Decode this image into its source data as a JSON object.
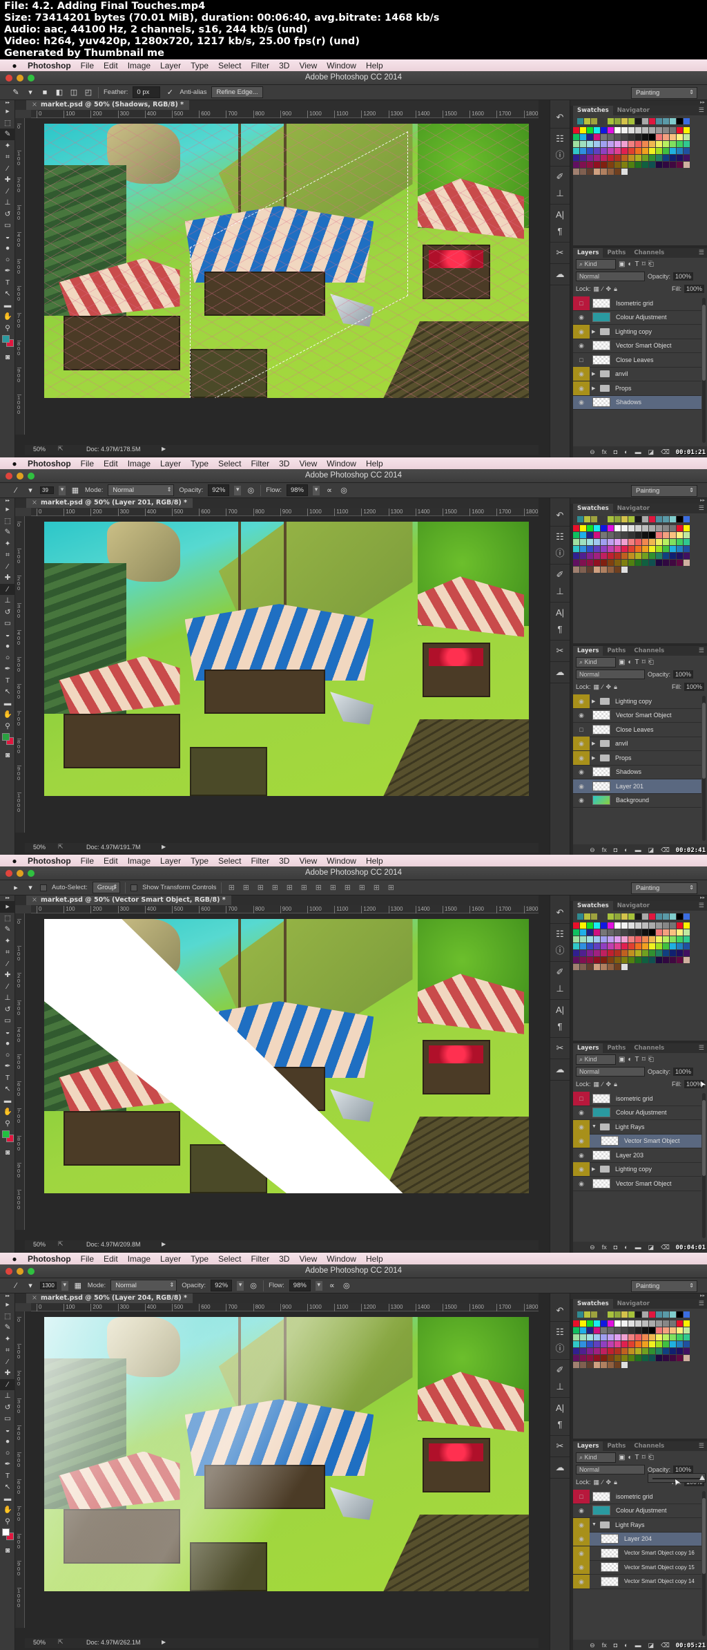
{
  "header": {
    "file_line": "File: 4.2. Adding Final Touches.mp4",
    "size_line": "Size: 73414201 bytes (70.01 MiB), duration: 00:06:40, avg.bitrate: 1468 kb/s",
    "audio_line": "Audio: aac, 44100 Hz, 2 channels, s16, 244 kb/s (und)",
    "video_line": "Video: h264, yuv420p, 1280x720, 1217 kb/s, 25.00 fps(r) (und)",
    "generated_line": "Generated by Thumbnail me"
  },
  "menubar": {
    "apple": "",
    "app": "Photoshop",
    "items": [
      "File",
      "Edit",
      "Image",
      "Layer",
      "Type",
      "Select",
      "Filter",
      "3D",
      "View",
      "Window",
      "Help"
    ]
  },
  "window_title": "Adobe Photoshop CC 2014",
  "workspace": "Painting",
  "ruler": {
    "h_ticks": [
      "0",
      "100",
      "200",
      "300",
      "400",
      "500",
      "600",
      "700",
      "800",
      "900",
      "1000",
      "1100",
      "1200",
      "1300",
      "1400",
      "1500",
      "1600",
      "1700",
      "1800"
    ],
    "v_ticks": [
      "0",
      "100",
      "200",
      "300",
      "400",
      "500",
      "600",
      "700",
      "800",
      "900",
      "1000"
    ]
  },
  "tools": [
    {
      "name": "move-tool",
      "glyph": "▸"
    },
    {
      "name": "marquee-tool",
      "glyph": "⬚"
    },
    {
      "name": "lasso-tool",
      "glyph": "✎"
    },
    {
      "name": "magic-wand-tool",
      "glyph": "✦"
    },
    {
      "name": "crop-tool",
      "glyph": "⌗"
    },
    {
      "name": "eyedropper-tool",
      "glyph": "⁄"
    },
    {
      "name": "healing-brush-tool",
      "glyph": "✚"
    },
    {
      "name": "brush-tool",
      "glyph": "∕"
    },
    {
      "name": "clone-stamp-tool",
      "glyph": "⊥"
    },
    {
      "name": "history-brush-tool",
      "glyph": "↺"
    },
    {
      "name": "eraser-tool",
      "glyph": "▭"
    },
    {
      "name": "paint-bucket-tool",
      "glyph": "◒"
    },
    {
      "name": "blur-tool",
      "glyph": "●"
    },
    {
      "name": "dodge-tool",
      "glyph": "○"
    },
    {
      "name": "pen-tool",
      "glyph": "✒"
    },
    {
      "name": "type-tool",
      "glyph": "T"
    },
    {
      "name": "path-selection-tool",
      "glyph": "↖"
    },
    {
      "name": "rectangle-tool",
      "glyph": "▬"
    },
    {
      "name": "hand-tool",
      "glyph": "✋"
    },
    {
      "name": "zoom-tool",
      "glyph": "⚲"
    }
  ],
  "dock_icons": [
    {
      "name": "history-icon",
      "glyph": "↶"
    },
    {
      "name": "properties-icon",
      "glyph": "☷"
    },
    {
      "name": "info-icon",
      "glyph": "ⓘ"
    },
    {
      "name": "brush-presets-icon",
      "glyph": "✐"
    },
    {
      "name": "clone-source-icon",
      "glyph": "⊥"
    },
    {
      "name": "character-icon",
      "glyph": "A|"
    },
    {
      "name": "paragraph-icon",
      "glyph": "¶"
    },
    {
      "name": "tool-presets-icon",
      "glyph": "✂"
    },
    {
      "name": "creative-cloud-icon",
      "glyph": "☁"
    }
  ],
  "swatches": {
    "tabs": [
      "Swatches",
      "Navigator"
    ],
    "recent": [
      "#2f8a91",
      "#b9c23d",
      "#9ea23e",
      "#3a3a3a",
      "#a8c33d",
      "#8fa83a",
      "#d4c24a",
      "#a6c23a",
      "#1a1a1a",
      "#a9a9a9",
      "#e0173f",
      "#4f8fa0",
      "#5a9aa8",
      "#7fcccc",
      "#000000",
      "#3b6de0"
    ],
    "grid": [
      "#e8102a",
      "#fff200",
      "#12e02a",
      "#18ecf0",
      "#1018e0",
      "#e010e0",
      "#ffffff",
      "#f2f2f2",
      "#e0e0e0",
      "#cfcfcf",
      "#bdbdbd",
      "#ababab",
      "#999999",
      "#878787",
      "#757575",
      "#e8102a",
      "#fff200",
      "#10c060",
      "#20b0e8",
      "#20208a",
      "#d01080",
      "#777777",
      "#666666",
      "#555555",
      "#444444",
      "#333333",
      "#222222",
      "#111111",
      "#000000",
      "#f07878",
      "#f4a080",
      "#f8c080",
      "#fff080",
      "#c0e8a0",
      "#a0e0a0",
      "#a0e0c0",
      "#a0e0e0",
      "#a0c8f0",
      "#a0a0f0",
      "#c0a0f0",
      "#e0a0f0",
      "#f0a0d0",
      "#f08080",
      "#f06060",
      "#f08850",
      "#f0b850",
      "#f0f060",
      "#b8f060",
      "#80e060",
      "#40d060",
      "#30c890",
      "#30c8c8",
      "#3090e0",
      "#3050c8",
      "#6040c0",
      "#9040c0",
      "#c040b0",
      "#e04090",
      "#e02050",
      "#e04030",
      "#f07020",
      "#f0a020",
      "#f0f020",
      "#a0e020",
      "#40c040",
      "#20b0e0",
      "#2080c0",
      "#2050a0",
      "#302090",
      "#502090",
      "#802090",
      "#a02080",
      "#c02060",
      "#c02030",
      "#b03020",
      "#c06020",
      "#c09020",
      "#b0b020",
      "#70a020",
      "#309030",
      "#208060",
      "#104080",
      "#102070",
      "#201060",
      "#401060",
      "#601060",
      "#801050",
      "#901040",
      "#901020",
      "#802010",
      "#804010",
      "#806010",
      "#808010",
      "#508010",
      "#207020",
      "#106040",
      "#105050",
      "#200840",
      "#300840",
      "#400840",
      "#600840",
      "#d0b0a0",
      "#a08070",
      "#806050",
      "#604030",
      "#d0a080",
      "#b08060",
      "#906040",
      "#704020",
      "#e0e0e0",
      "#3c3c3c",
      "#3c3c3c",
      "#3c3c3c",
      "#3c3c3c"
    ]
  },
  "layers_panel": {
    "tabs": [
      "Layers",
      "Paths",
      "Channels"
    ],
    "kind": "Kind",
    "blend": "Normal",
    "opacity_label": "Opacity:",
    "fill_label": "Fill:",
    "lock_label": "Lock:",
    "opacity_value": "100%",
    "fill_value": "100%"
  },
  "frames": [
    {
      "options": {
        "tool": "lasso",
        "feather_label": "Feather:",
        "feather_value": "0 px",
        "antialias_label": "Anti-alias",
        "refine_label": "Refine Edge..."
      },
      "doc_tab": "market.psd @ 50% (Shadows, RGB/8) *",
      "zoom": "50%",
      "doc_info": "Doc: 4.97M/178.5M",
      "fg_color": "#2a9aa0",
      "bg_color": "#e0173f",
      "timestamp": "00:01:21",
      "layers": [
        {
          "name": "Isometric grid",
          "eye": "red",
          "type": "layer",
          "partial": true
        },
        {
          "name": "Colour Adjustment",
          "eye": "on",
          "type": "fill",
          "fill": "#2a9aa0"
        },
        {
          "name": "Lighting copy",
          "eye": "yellow",
          "type": "group"
        },
        {
          "name": "Vector Smart Object",
          "eye": "on",
          "type": "smart"
        },
        {
          "name": "Close Leaves",
          "eye": "off",
          "type": "layer"
        },
        {
          "name": "anvil",
          "eye": "yellow",
          "type": "group"
        },
        {
          "name": "Props",
          "eye": "yellow",
          "type": "group"
        },
        {
          "name": "Shadows",
          "eye": "on",
          "type": "layer",
          "selected": true
        }
      ]
    },
    {
      "options": {
        "tool": "brush",
        "brush_size": "39",
        "mode_label": "Mode:",
        "mode_value": "Normal",
        "opacity_label": "Opacity:",
        "opacity_value": "92%",
        "flow_label": "Flow:",
        "flow_value": "98%"
      },
      "doc_tab": "market.psd @ 50% (Layer 201, RGB/8) *",
      "zoom": "50%",
      "doc_info": "Doc: 4.97M/191.7M",
      "fg_color": "#2aa040",
      "bg_color": "#e0173f",
      "timestamp": "00:02:41",
      "layers": [
        {
          "name": "Lighting copy",
          "eye": "yellow",
          "type": "group"
        },
        {
          "name": "Vector Smart Object",
          "eye": "on",
          "type": "smart"
        },
        {
          "name": "Close Leaves",
          "eye": "off",
          "type": "layer"
        },
        {
          "name": "anvil",
          "eye": "yellow",
          "type": "group"
        },
        {
          "name": "Props",
          "eye": "yellow",
          "type": "group"
        },
        {
          "name": "Shadows",
          "eye": "on",
          "type": "layer"
        },
        {
          "name": "Layer 201",
          "eye": "on",
          "type": "layer",
          "selected": true
        },
        {
          "name": "Background",
          "eye": "on",
          "type": "image"
        }
      ]
    },
    {
      "options": {
        "tool": "move",
        "autoselect_label": "Auto-Select:",
        "autoselect_value": "Group",
        "transform_label": "Show Transform Controls"
      },
      "doc_tab": "market.psd @ 50% (Vector Smart Object, RGB/8) *",
      "zoom": "50%",
      "doc_info": "Doc: 4.97M/209.8M",
      "fg_color": "#20c040",
      "bg_color": "#e0173f",
      "timestamp": "00:04:01",
      "layers": [
        {
          "name": "isometric grid",
          "eye": "red",
          "type": "layer"
        },
        {
          "name": "Colour Adjustment",
          "eye": "on",
          "type": "fill",
          "fill": "#2a9aa0"
        },
        {
          "name": "Light Rays",
          "eye": "yellow",
          "type": "group-open"
        },
        {
          "name": "Vector Smart Object",
          "eye": "yellow",
          "type": "layer",
          "child": true,
          "selected": true
        },
        {
          "name": "Layer 203",
          "eye": "on",
          "type": "layer"
        },
        {
          "name": "Lighting copy",
          "eye": "yellow",
          "type": "group"
        },
        {
          "name": "Vector Smart Object",
          "eye": "on",
          "type": "smart"
        }
      ]
    },
    {
      "options": {
        "tool": "brush",
        "brush_size": "1300",
        "mode_label": "Mode:",
        "mode_value": "Normal",
        "opacity_label": "Opacity:",
        "opacity_value": "92%",
        "flow_label": "Flow:",
        "flow_value": "98%"
      },
      "doc_tab": "market.psd @ 50% (Layer 204, RGB/8) *",
      "zoom": "50%",
      "doc_info": "Doc: 4.97M/262.1M",
      "fg_color": "#ffffff",
      "bg_color": "#e0173f",
      "timestamp": "00:05:21",
      "opacity_slider": 1.0,
      "layers": [
        {
          "name": "isometric grid",
          "eye": "red",
          "type": "layer"
        },
        {
          "name": "Colour Adjustment",
          "eye": "on",
          "type": "fill",
          "fill": "#2a9aa0"
        },
        {
          "name": "Light Rays",
          "eye": "yellow",
          "type": "group-open"
        },
        {
          "name": "Layer 204",
          "eye": "yellow",
          "type": "layer",
          "child": true,
          "selected": true
        },
        {
          "name": "Vector Smart Object copy 16",
          "eye": "yellow",
          "type": "layer",
          "child": true
        },
        {
          "name": "Vector Smart Object copy 15",
          "eye": "yellow",
          "type": "layer",
          "child": true
        },
        {
          "name": "Vector Smart Object copy 14",
          "eye": "yellow",
          "type": "layer",
          "child": true
        }
      ]
    }
  ],
  "footer_icons": [
    "link-icon",
    "fx-icon",
    "mask-icon",
    "adjustment-icon",
    "folder-icon",
    "new-layer-icon",
    "trash-icon"
  ],
  "colors": {
    "eye_yellow": "#a8901a",
    "eye_red": "#b8183c",
    "selected_layer": "#5a6880",
    "traffic_red": "#e0443c",
    "traffic_yellow": "#e0a020",
    "traffic_green": "#30c040"
  }
}
